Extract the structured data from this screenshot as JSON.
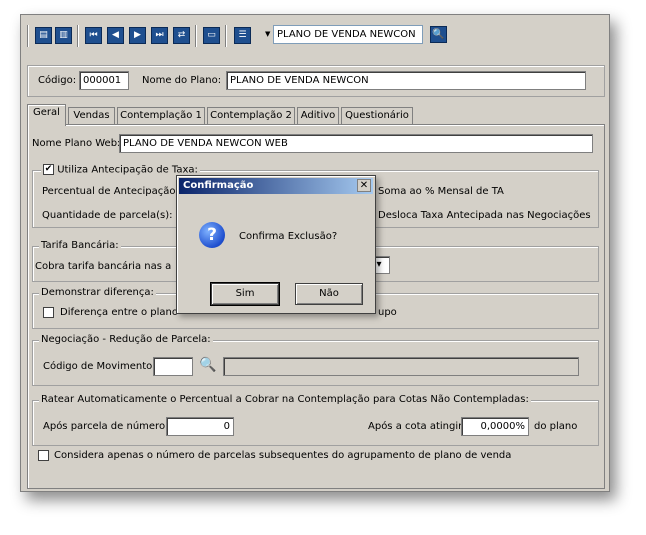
{
  "toolbar": {
    "buttons": [
      {
        "icon": "new-document-icon",
        "glyph": "▤"
      },
      {
        "icon": "delete-icon",
        "glyph": "▥"
      },
      {
        "icon": "first-record-icon",
        "glyph": "⏮"
      },
      {
        "icon": "previous-record-icon",
        "glyph": "◀"
      },
      {
        "icon": "next-record-icon",
        "glyph": "▶"
      },
      {
        "icon": "last-record-icon",
        "glyph": "⏭"
      },
      {
        "icon": "refresh-icon",
        "glyph": "⇄"
      },
      {
        "icon": "print-icon",
        "glyph": "▭"
      },
      {
        "icon": "list-icon",
        "glyph": "☰"
      }
    ],
    "combo_value": "PLANO DE VENDA NEWCON",
    "search_glyph": "🔍"
  },
  "header": {
    "codigo_label": "Código:",
    "codigo_value": "000001",
    "nome_label": "Nome do Plano:",
    "nome_value": "PLANO DE VENDA NEWCON"
  },
  "tabs": [
    "Geral",
    "Vendas",
    "Contemplação 1",
    "Contemplação 2",
    "Aditivo",
    "Questionário"
  ],
  "geral": {
    "nome_web_label": "Nome Plano Web:",
    "nome_web_value": "PLANO DE VENDA NEWCON WEB",
    "antecipacao": {
      "checkbox_label": "Utiliza Antecipação de Taxa:",
      "checked": true,
      "percentual_label": "Percentual de Antecipação",
      "quantidade_label": "Quantidade de parcela(s):",
      "soma_label": "Soma ao % Mensal de TA",
      "desloca_label": "Desloca Taxa Antecipada nas Negociações"
    },
    "tarifa": {
      "legend": "Tarifa Bancária:",
      "cobra_label": "Cobra tarifa bancária nas a"
    },
    "demonstrar": {
      "legend": "Demonstrar diferença:",
      "diferenca_label": "Diferença entre o plano",
      "grupo_suffix": "upo"
    },
    "negociacao": {
      "legend": "Negociação - Redução de Parcela:",
      "codigo_mov_label": "Código de Movimento:",
      "codigo_mov_value": "",
      "descricao_value": ""
    },
    "ratear": {
      "legend": "Ratear Automaticamente o Percentual a Cobrar na Contemplação para Cotas Não Contempladas:",
      "apos_parcela_label": "Após parcela de número:",
      "apos_parcela_value": "0",
      "apos_cota_label": "Após a cota atingir",
      "apos_cota_value": "0,0000%",
      "do_plano_label": "do plano"
    },
    "considera_label": "Considera apenas o número de parcelas subsequentes do agrupamento de plano de venda"
  },
  "dialog": {
    "title": "Confirmação",
    "close_glyph": "✕",
    "icon_glyph": "?",
    "message": "Confirma Exclusão?",
    "yes_label": "Sim",
    "no_label": "Não"
  }
}
